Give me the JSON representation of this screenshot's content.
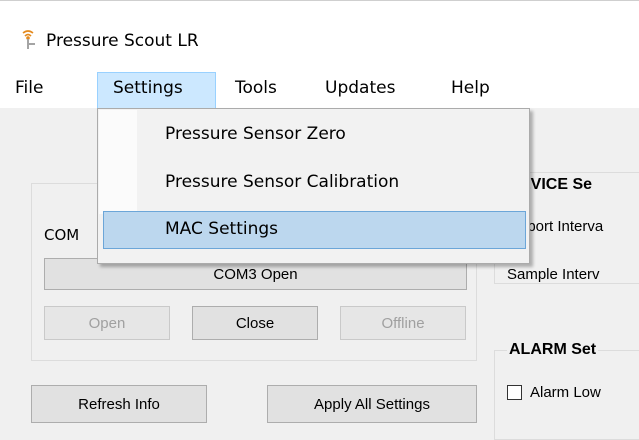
{
  "window": {
    "title": "Pressure Scout LR"
  },
  "menu": {
    "items": [
      "File",
      "Settings",
      "Tools",
      "Updates",
      "Help"
    ],
    "active": "Settings"
  },
  "settings_menu": {
    "items": [
      "Pressure Sensor Zero",
      "Pressure Sensor Calibration",
      "MAC Settings"
    ],
    "highlighted": "MAC Settings"
  },
  "connection": {
    "port_label": "COM",
    "status_button": "COM3 Open",
    "open_label": "Open",
    "close_label": "Close",
    "offline_label": "Offline"
  },
  "actions": {
    "refresh_label": "Refresh Info",
    "apply_label": "Apply All Settings"
  },
  "device_settings": {
    "title": "EVICE Se",
    "report_interval": "eport Interva",
    "sample_interval": "Sample Interv"
  },
  "alarm_settings": {
    "title": "ALARM Set",
    "alarm_low": "Alarm Low"
  }
}
